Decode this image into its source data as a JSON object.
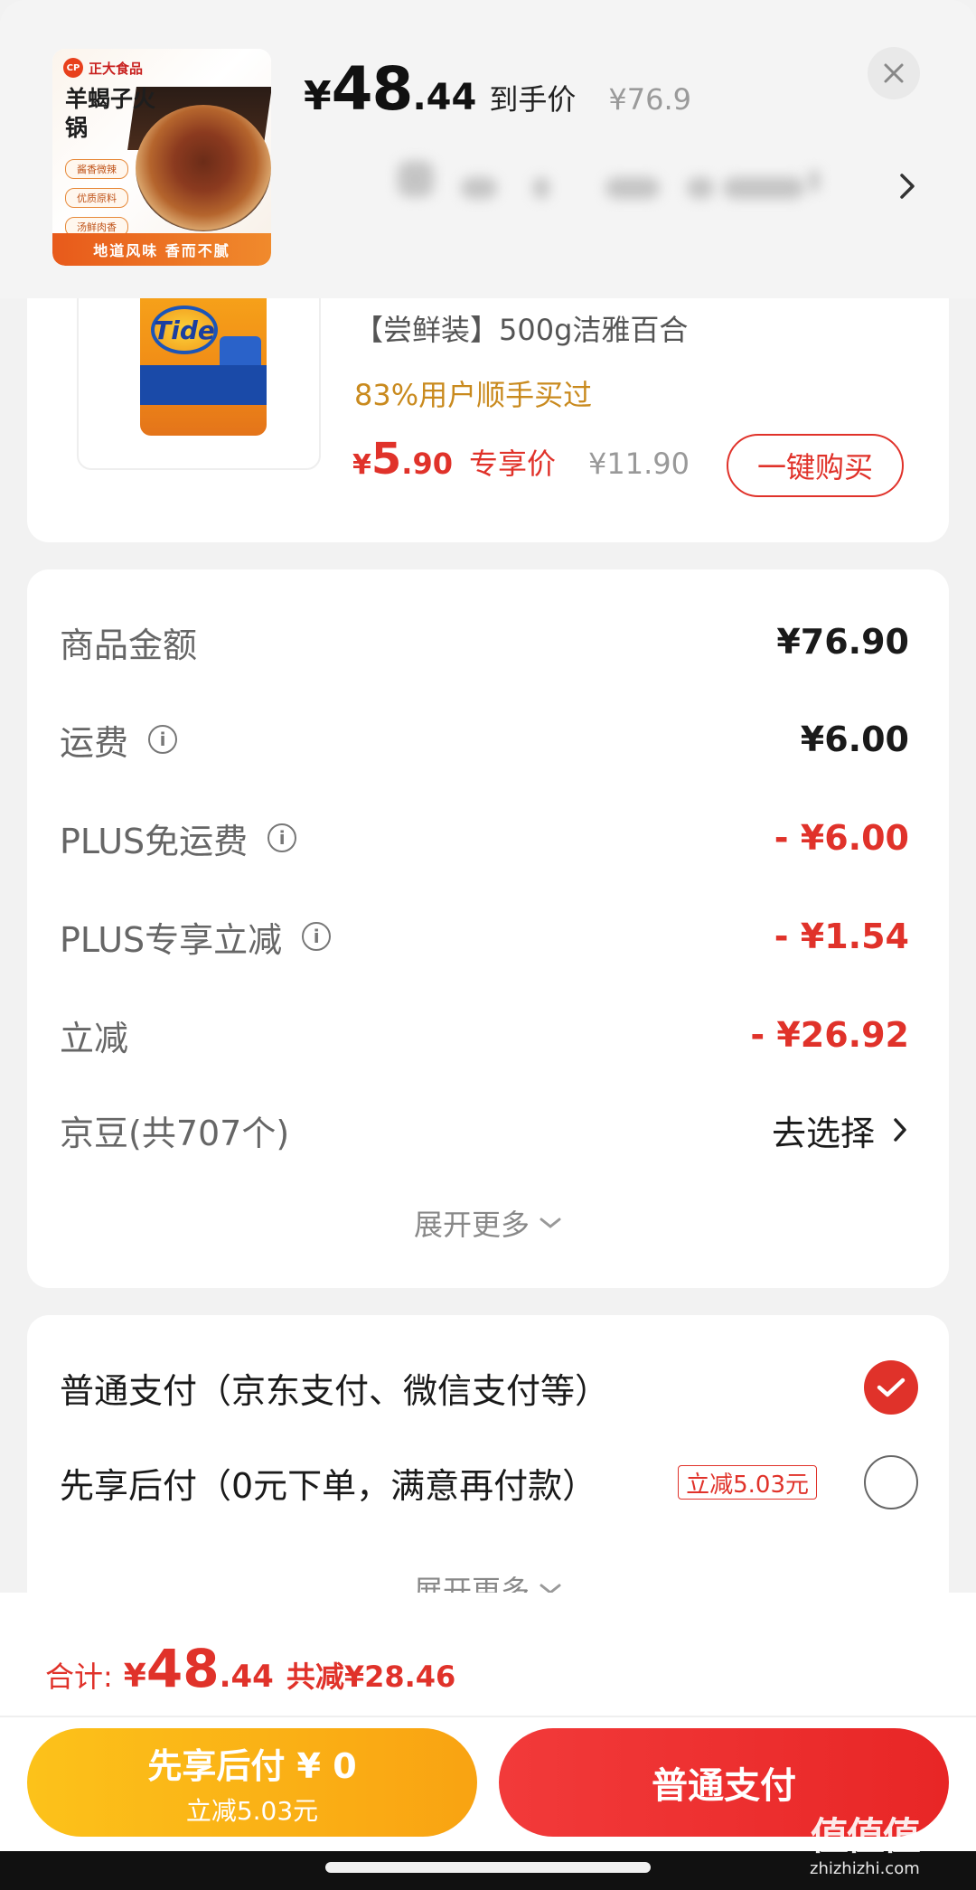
{
  "header": {
    "brand_label": "正大食品",
    "thumb_title": "羊蝎子火锅",
    "thumb_tags": [
      "酱香微辣",
      "优质原料",
      "汤鲜肉香"
    ],
    "thumb_footer": "地道风味 香而不腻",
    "price_yen": "¥",
    "price_int": "48",
    "price_dec": ".44",
    "price_tag": "到手价",
    "original_price": "¥76.9",
    "close_icon": "close-icon"
  },
  "recommend": {
    "image_brand": "Tide",
    "title": "【尝鲜装】500g洁雅百合",
    "rate": "83%用户顺手买过",
    "price_yen": "¥",
    "price_int": "5",
    "price_dec": ".90",
    "price_tag": "专享价",
    "original_price": "¥11.90",
    "buy_label": "一键购买"
  },
  "amounts": {
    "rows": [
      {
        "label": "商品金额",
        "value": "¥76.90"
      },
      {
        "label": "运费",
        "value": "¥6.00"
      },
      {
        "label": "PLUS免运费",
        "value": "- ¥6.00"
      },
      {
        "label": "PLUS专享立减",
        "value": "- ¥1.54"
      },
      {
        "label": "立减",
        "value": "- ¥26.92"
      },
      {
        "label": "京豆(共707个)",
        "value": "去选择"
      }
    ],
    "expand_label": "展开更多"
  },
  "payment": {
    "methods": [
      {
        "label": "普通支付（京东支付、微信支付等）",
        "selected": true
      },
      {
        "label": "先享后付（0元下单，满意再付款）",
        "badge": "立减5.03元",
        "selected": false
      }
    ],
    "expand_label": "展开更多"
  },
  "summary": {
    "label": "合计:",
    "yen": "¥",
    "int": "48",
    "dec": ".44",
    "discount": "共减¥28.46"
  },
  "buttons": {
    "later_main": "先享后付 ¥ 0",
    "later_sub": "立减5.03元",
    "normal": "普通支付"
  },
  "watermark": {
    "logo": "值值值",
    "url": "zhizhizhi.com"
  },
  "colors": {
    "accent_red": "#e0322a",
    "later_yellow": "#fcc21a",
    "rate_gold": "#c98a1e"
  }
}
